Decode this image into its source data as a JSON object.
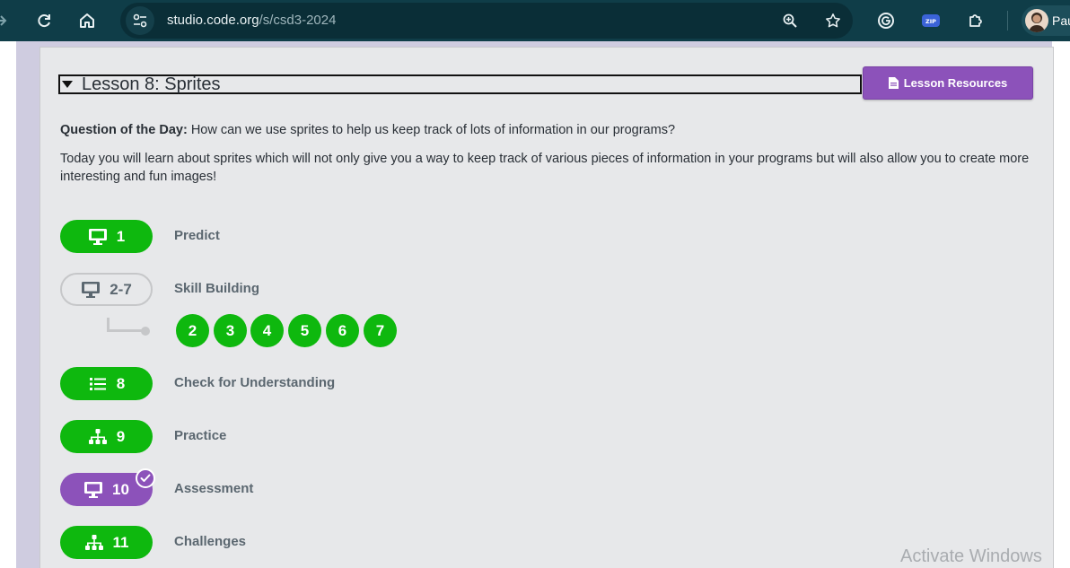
{
  "browser": {
    "url_domain": "studio.code.org",
    "url_path": "/s/csd3-2024",
    "profile_name": "Pau",
    "extension_zip_label": "ZIP"
  },
  "lesson": {
    "title": "Lesson 8: Sprites",
    "resources_label": "Lesson Resources",
    "qotd_label": "Question of the Day:",
    "qotd_text": " How can we use sprites to help us keep track of lots of information in our programs?",
    "description": "Today you will learn about sprites which will not only give you a way to keep track of various pieces of information in your programs but will also allow you to create more interesting and fun images!"
  },
  "levels": [
    {
      "number": "1",
      "name": "Predict",
      "icon": "monitor-icon",
      "color": "#0eb80e"
    },
    {
      "number": "2-7",
      "name": "Skill Building",
      "icon": "monitor-icon",
      "color": "#c6c7c9"
    },
    {
      "number": "8",
      "name": "Check for Understanding",
      "icon": "list-icon",
      "color": "#0eb80e"
    },
    {
      "number": "9",
      "name": "Practice",
      "icon": "hierarchy-icon",
      "color": "#0eb80e"
    },
    {
      "number": "10",
      "name": "Assessment",
      "icon": "monitor-icon",
      "color": "#8c52ba"
    },
    {
      "number": "11",
      "name": "Challenges",
      "icon": "hierarchy-icon",
      "color": "#0eb80e"
    }
  ],
  "sublevels": [
    "2",
    "3",
    "4",
    "5",
    "6",
    "7"
  ],
  "watermark": "Activate Windows"
}
